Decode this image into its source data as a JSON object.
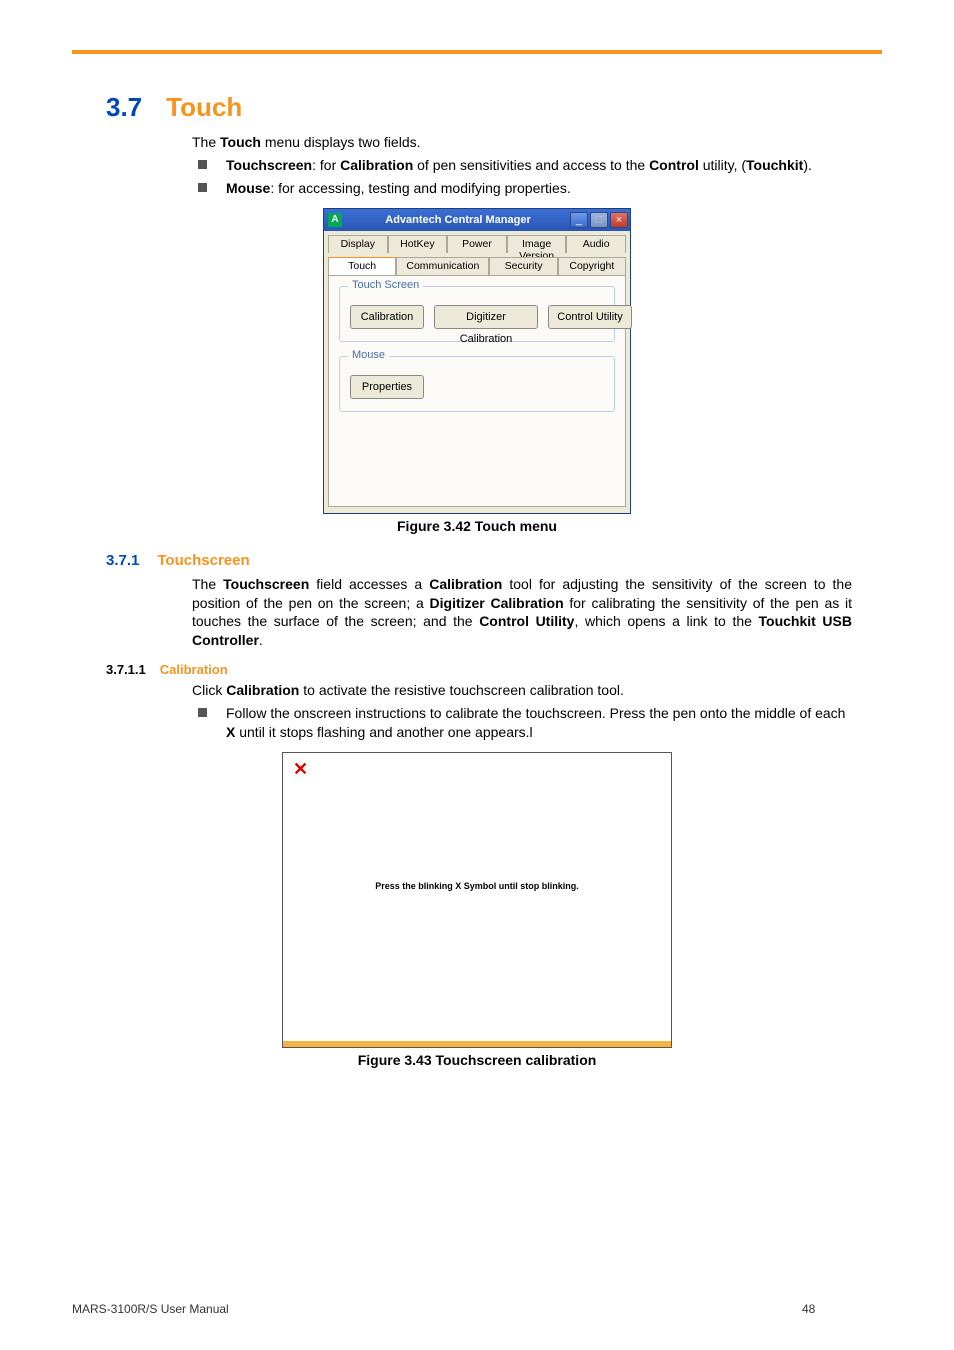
{
  "section": {
    "number": "3.7",
    "title": "Touch",
    "intro_pre": "The ",
    "intro_bold": "Touch",
    "intro_post": " menu displays two fields.",
    "bullets": [
      {
        "b1": "Touchscreen",
        "t1": ": for ",
        "b2": "Calibration",
        "t2": " of pen sensitivities and access to the ",
        "b3": "Control",
        "t3": " utility, (",
        "b4": "Touchkit",
        "t4": ")."
      },
      {
        "b1": "Mouse",
        "t1": ": for accessing, testing and modifying properties."
      }
    ]
  },
  "window": {
    "app_letter": "A",
    "title": "Advantech Central Manager",
    "minimize": "_",
    "maximize": "□",
    "close": "×",
    "tabs_row1": [
      "Display",
      "HotKey",
      "Power",
      "Image Version",
      "Audio"
    ],
    "tabs_row2": [
      "Touch",
      "Communication",
      "Security",
      "Copyright"
    ],
    "group1_legend": "Touch Screen",
    "btn_calibration": "Calibration",
    "btn_digitizer": "Digitizer Calibration",
    "btn_control": "Control Utility",
    "group2_legend": "Mouse",
    "btn_properties": "Properties"
  },
  "fig1_caption": "Figure 3.42 Touch menu",
  "subsection": {
    "number": "3.7.1",
    "title": "Touchscreen",
    "para": {
      "t0": "The ",
      "b1": "Touchscreen",
      "t1": " field accesses a ",
      "b2": "Calibration",
      "t2": " tool for adjusting the sensitivity of the screen to the position of the pen on the screen; a ",
      "b3": "Digitizer Calibration",
      "t3": " for calibrating the sensitivity of the pen as it touches the surface of the screen; and the ",
      "b4": "Control Utility",
      "t4": ", which opens a link to the ",
      "b5": "Touchkit USB Controller",
      "t5": "."
    }
  },
  "subsubsection": {
    "number": "3.7.1.1",
    "title": "Calibration",
    "line1_pre": "Click ",
    "line1_bold": "Calibration",
    "line1_post": " to activate the resistive touchscreen calibration tool.",
    "bullet": {
      "t0": "Follow the onscreen instructions to calibrate the touchscreen. Press the pen onto the middle of each ",
      "b1": "X",
      "t1": " until it stops flashing and another one appears.l"
    }
  },
  "calwin": {
    "x": "✕",
    "msg": "Press the blinking X Symbol until stop blinking."
  },
  "fig2_caption": "Figure 3.43 Touchscreen calibration",
  "footer": {
    "left": "MARS-3100R/S User Manual",
    "page": "48"
  }
}
